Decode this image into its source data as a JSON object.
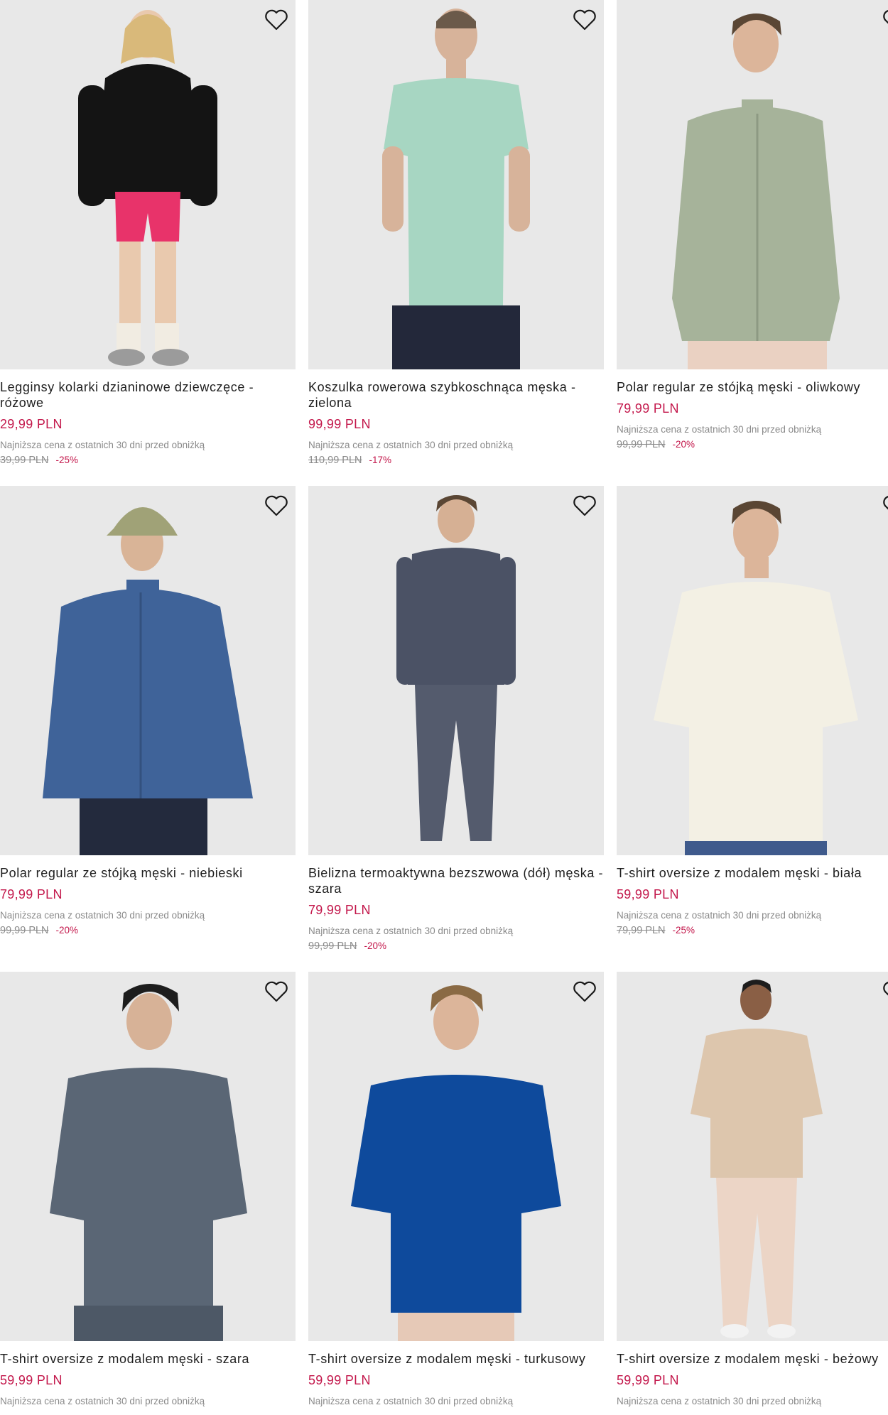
{
  "favorite_icon": "heart-outline-icon",
  "colors": {
    "price": "#c3174b",
    "tile_bg": "#e8e8e8"
  },
  "products": [
    {
      "name": "Legginsy kolarki dzianinowe dziewczęce - różowe",
      "price": "29,99 PLN",
      "lowest_label": "Najniższa cena z ostatnich 30 dni przed obniżką",
      "old_price": "39,99 PLN",
      "discount": "-25%"
    },
    {
      "name": "Koszulka rowerowa szybkoschnąca męska - zielona",
      "price": "99,99 PLN",
      "lowest_label": "Najniższa cena z ostatnich 30 dni przed obniżką",
      "old_price": "110,99 PLN",
      "discount": "-17%"
    },
    {
      "name": "Polar regular ze stójką męski - oliwkowy",
      "price": "79,99 PLN",
      "lowest_label": "Najniższa cena z ostatnich 30 dni przed obniżką",
      "old_price": "99,99 PLN",
      "discount": "-20%"
    },
    {
      "name": "Polar regular ze stójką męski - niebieski",
      "price": "79,99 PLN",
      "lowest_label": "Najniższa cena z ostatnich 30 dni przed obniżką",
      "old_price": "99,99 PLN",
      "discount": "-20%"
    },
    {
      "name": "Bielizna termoaktywna bezszwowa (dół) męska - szara",
      "price": "79,99 PLN",
      "lowest_label": "Najniższa cena z ostatnich 30 dni przed obniżką",
      "old_price": "99,99 PLN",
      "discount": "-20%"
    },
    {
      "name": "T-shirt oversize z modalem męski - biała",
      "price": "59,99 PLN",
      "lowest_label": "Najniższa cena z ostatnich 30 dni przed obniżką",
      "old_price": "79,99 PLN",
      "discount": "-25%"
    },
    {
      "name": "T-shirt oversize z modalem męski - szara",
      "price": "59,99 PLN",
      "lowest_label": "Najniższa cena z ostatnich 30 dni przed obniżką"
    },
    {
      "name": "T-shirt oversize z modalem męski - turkusowy",
      "price": "59,99 PLN",
      "lowest_label": "Najniższa cena z ostatnich 30 dni przed obniżką"
    },
    {
      "name": "T-shirt oversize z modalem męski - beżowy",
      "price": "59,99 PLN",
      "lowest_label": "Najniższa cena z ostatnich 30 dni przed obniżką"
    }
  ]
}
